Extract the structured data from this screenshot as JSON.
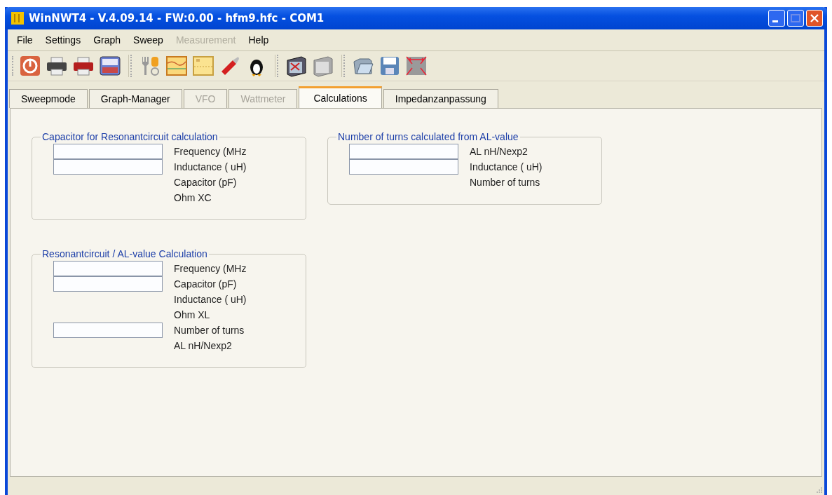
{
  "window": {
    "title": "WinNWT4 - V.4.09.14 - FW:0.00 - hfm9.hfc - COM1"
  },
  "menu": [
    {
      "label": "File",
      "disabled": false
    },
    {
      "label": "Settings",
      "disabled": false
    },
    {
      "label": "Graph",
      "disabled": false
    },
    {
      "label": "Sweep",
      "disabled": false
    },
    {
      "label": "Measurement",
      "disabled": true
    },
    {
      "label": "Help",
      "disabled": false
    }
  ],
  "tabs": [
    {
      "label": "Sweepmode",
      "selected": false,
      "disabled": false
    },
    {
      "label": "Graph-Manager",
      "selected": false,
      "disabled": false
    },
    {
      "label": "VFO",
      "selected": false,
      "disabled": true
    },
    {
      "label": "Wattmeter",
      "selected": false,
      "disabled": true
    },
    {
      "label": "Calculations",
      "selected": true,
      "disabled": false
    },
    {
      "label": "Impedanzanpassung",
      "selected": false,
      "disabled": false
    }
  ],
  "groups": [
    {
      "title": "Capacitor for Resonantcircuit calculation",
      "rows": [
        {
          "kind": "input",
          "label": "Frequency (MHz"
        },
        {
          "kind": "input",
          "label": "Inductance ( uH)"
        },
        {
          "kind": "output",
          "label": "Capacitor (pF)"
        },
        {
          "kind": "output",
          "label": "Ohm XC"
        }
      ]
    },
    {
      "title": "Number of turns calculated from AL-value",
      "rows": [
        {
          "kind": "input",
          "label": "AL nH/Nexp2"
        },
        {
          "kind": "input",
          "label": "Inductance ( uH)"
        },
        {
          "kind": "output",
          "label": "Number of turns"
        }
      ]
    },
    {
      "title": "Resonantcircuit / AL-value Calculation",
      "rows": [
        {
          "kind": "input",
          "label": "Frequency (MHz"
        },
        {
          "kind": "input",
          "label": "Capacitor (pF)"
        },
        {
          "kind": "output",
          "label": "Inductance ( uH)"
        },
        {
          "kind": "output",
          "label": "Ohm XL"
        },
        {
          "kind": "input",
          "label": "Number of turns"
        },
        {
          "kind": "output",
          "label": "AL nH/Nexp2"
        }
      ]
    }
  ]
}
